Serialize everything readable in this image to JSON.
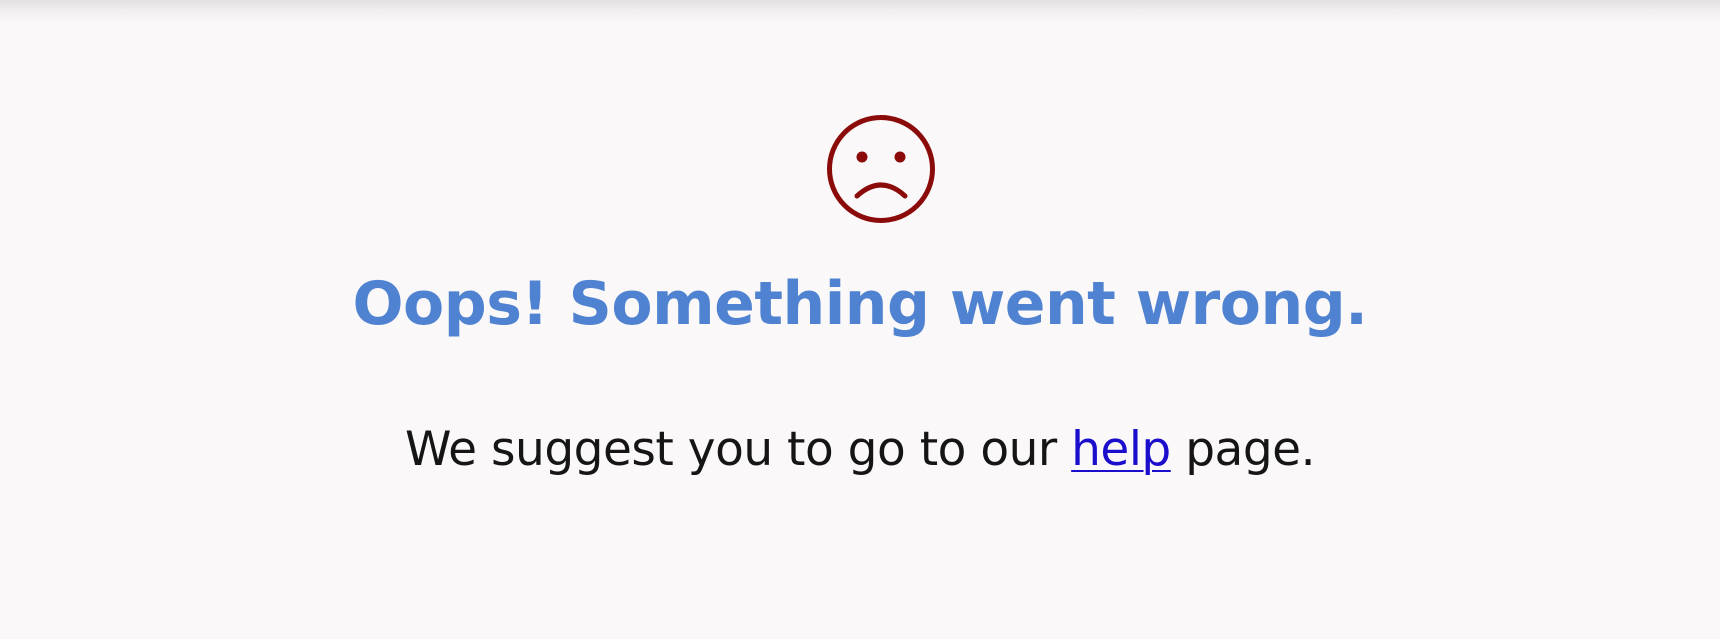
{
  "error": {
    "icon": "sad-face-icon",
    "icon_color": "#8b0b0b",
    "headline": "Oops! Something went wrong.",
    "headline_color": "#4f82d0",
    "message_before": "We suggest you to go to our ",
    "link_label": "help",
    "link_color": "#1a0dcc",
    "message_after": " page."
  }
}
